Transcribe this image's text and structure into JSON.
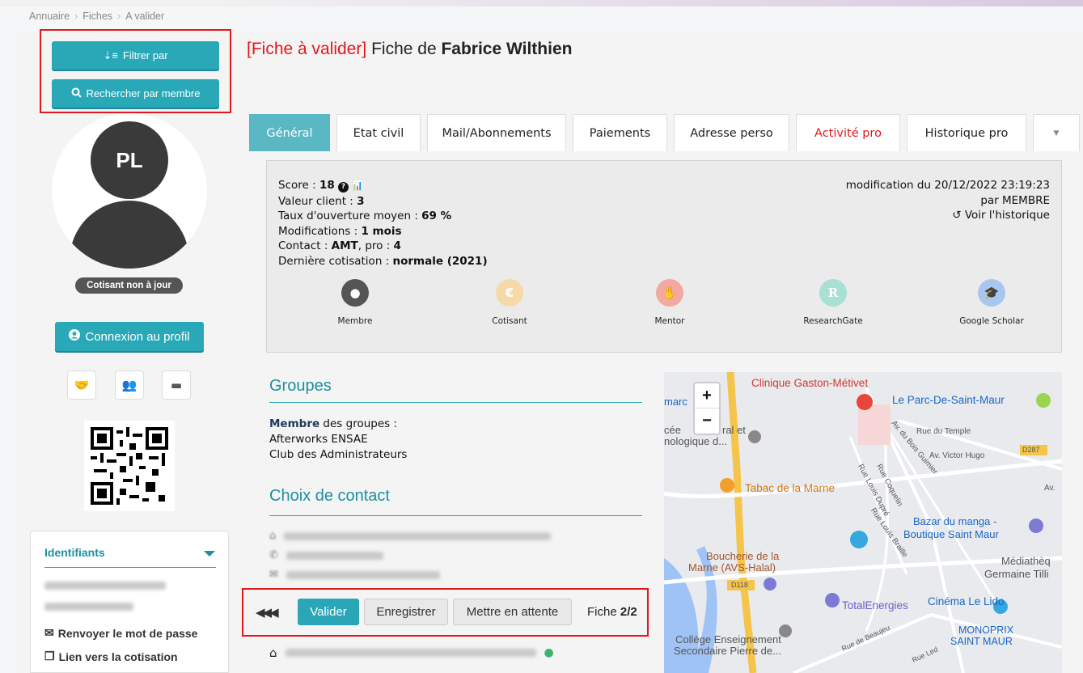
{
  "breadcrumb": [
    "Annuaire",
    "Fiches",
    "A valider"
  ],
  "sidebar": {
    "filter_label": "Filtrer par",
    "search_member_label": "Rechercher par membre",
    "avatar_initials": "PL",
    "status_badge": "Cotisant non à jour",
    "connect_label": "Connexion au profil",
    "identifiants": {
      "title": "Identifiants",
      "resend_password": "Renvoyer le mot de passe",
      "cotisation_link": "Lien vers la cotisation"
    }
  },
  "title": {
    "prefix": "[Fiche à valider]",
    "middle": "Fiche de",
    "name": "Fabrice Wilthien"
  },
  "tabs": [
    "Général",
    "Etat civil",
    "Mail/Abonnements",
    "Paiements",
    "Adresse perso",
    "Activité pro",
    "Historique pro"
  ],
  "info": {
    "score_label": "Score : ",
    "score_value": "18",
    "client_label": "Valeur client : ",
    "client_value": "3",
    "open_rate_label": "Taux d'ouverture moyen : ",
    "open_rate_value": "69 %",
    "modifs_label": "Modifications : ",
    "modifs_value": "1 mois",
    "contact_label": "Contact : ",
    "contact_value": "AMT",
    "contact_pro_label": ", pro : ",
    "contact_pro_value": "4",
    "cotisation_label": "Dernière cotisation : ",
    "cotisation_value": "normale (2021)",
    "modified": "modification du 20/12/2022 23:19:23",
    "by": "par MEMBRE",
    "history_link": "Voir l'historique"
  },
  "status_icons": [
    {
      "label": "Membre",
      "color": "#555555",
      "icon": "user-icon"
    },
    {
      "label": "Cotisant",
      "color": "#f5d9a8",
      "icon": "euro-user-icon"
    },
    {
      "label": "Mentor",
      "color": "#f2aaa0",
      "icon": "hand-icon"
    },
    {
      "label": "ResearchGate",
      "color": "#a8e0d4",
      "icon": "researchgate-icon"
    },
    {
      "label": "Google Scholar",
      "color": "#a9c6f0",
      "icon": "scholar-icon"
    }
  ],
  "groups": {
    "title": "Groupes",
    "intro_bold": "Membre",
    "intro_rest": " des groupes :",
    "items": [
      "Afterworks ENSAE",
      "Club des Administrateurs"
    ]
  },
  "contact_choice": {
    "title": "Choix de contact"
  },
  "actions": {
    "validate": "Valider",
    "save": "Enregistrer",
    "hold": "Mettre en attente",
    "fiche_label": "Fiche ",
    "fiche_value": "2/2"
  },
  "map": {
    "labels": [
      "Clinique Gaston-Métivet",
      "Le Parc-De-Saint-Maur",
      "Rue du Temple",
      "Av. Victor Hugo",
      "D287",
      "Tabac de la Marne",
      "Bazar du manga -",
      "Boutique Saint Maur",
      "Boucherie de la",
      "Marne (AVS-Halal)",
      "D118",
      "Médiathèq",
      "Germaine Tilli",
      "TotalEnergies",
      "Cinéma Le Lido",
      "MONOPRIX",
      "SAINT MAUR",
      "Collège Enseignement",
      "Secondaire Pierre de...",
      "marc",
      "cée",
      "ral et",
      "nologique d...",
      "Av.",
      "Rue Coquelin",
      "Rue Louis Dupré",
      "Rue Louis Braille",
      "Av. du Bois Guimier",
      "Rue de Beaujeu",
      "Rue Led"
    ],
    "zoom_in": "+",
    "zoom_out": "−"
  }
}
